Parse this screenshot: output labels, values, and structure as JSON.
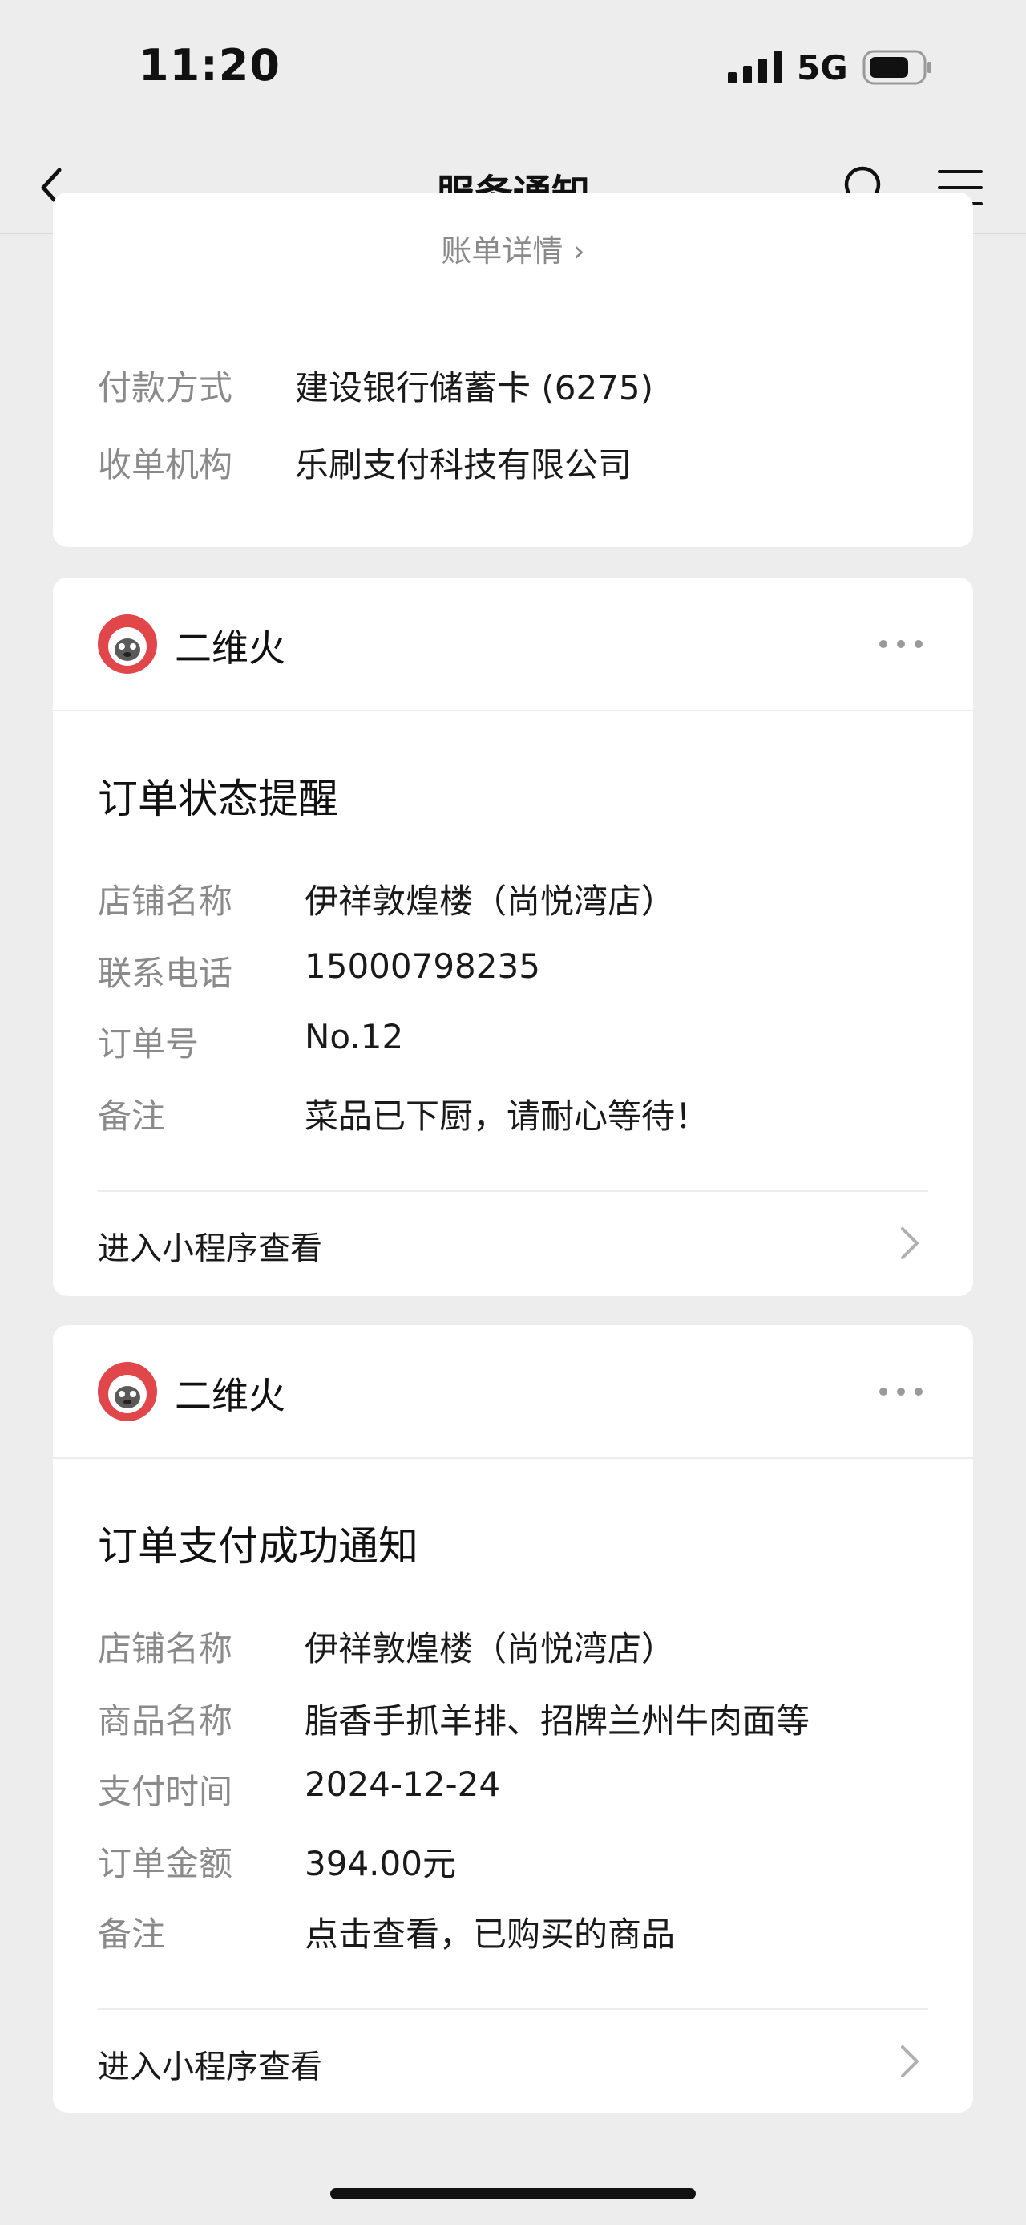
{
  "status_bar": {
    "time": "11:20",
    "network": "5G"
  },
  "nav": {
    "title": "服务通知"
  },
  "card1": {
    "bill_link": "账单详情 ›",
    "rows": [
      {
        "label": "付款方式",
        "value": "建设银行储蓄卡 (6275)"
      },
      {
        "label": "收单机构",
        "value": "乐刷支付科技有限公司"
      }
    ]
  },
  "card2": {
    "brand": "二维火",
    "title": "订单状态提醒",
    "rows": [
      {
        "label": "店铺名称",
        "value": "伊祥敦煌楼（尚悦湾店）"
      },
      {
        "label": "联系电话",
        "value": "15000798235"
      },
      {
        "label": "订单号",
        "value": "No.12"
      },
      {
        "label": "备注",
        "value": "菜品已下厨，请耐心等待！"
      }
    ],
    "link_label": "进入小程序查看"
  },
  "card3": {
    "brand": "二维火",
    "title": "订单支付成功通知",
    "rows": [
      {
        "label": "店铺名称",
        "value": "伊祥敦煌楼（尚悦湾店）"
      },
      {
        "label": "商品名称",
        "value": "脂香手抓羊排、招牌兰州牛肉面等"
      },
      {
        "label": "支付时间",
        "value": "2024-12-24"
      },
      {
        "label": "订单金额",
        "value": "394.00元"
      },
      {
        "label": "备注",
        "value": "点击查看，已购买的商品"
      }
    ],
    "link_label": "进入小程序查看"
  },
  "icons": {
    "back": "back-icon",
    "search": "search-icon",
    "menu": "menu-icon",
    "more": "more-icon",
    "chevron": "chevron-right-icon",
    "signal": "signal-icon",
    "battery": "battery-icon",
    "avatar": "avatar-icon"
  },
  "colors": {
    "background": "#ededed",
    "card": "#ffffff",
    "label_gray": "#8a8a8a",
    "avatar_red": "#e0464a"
  }
}
